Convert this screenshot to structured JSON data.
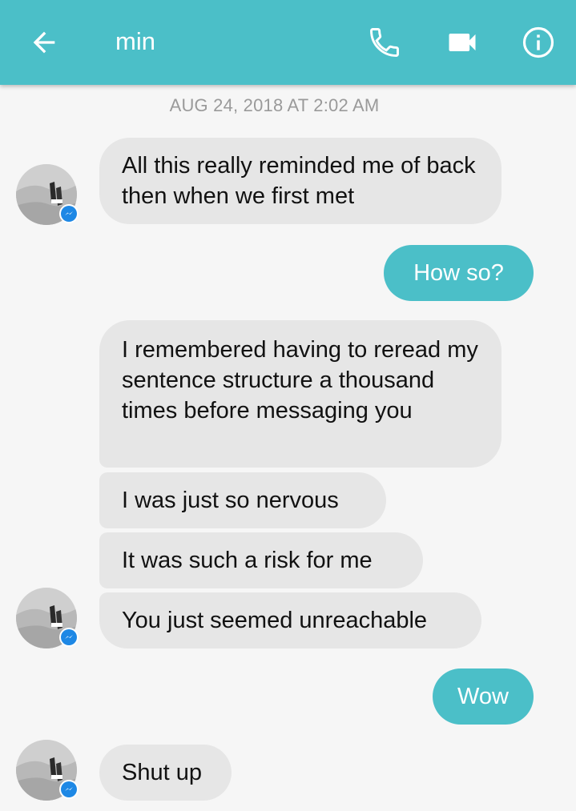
{
  "header": {
    "contact_name": "min",
    "back_icon": "arrow-left-icon",
    "call_icon": "phone-icon",
    "video_icon": "video-camera-icon",
    "info_icon": "info-icon",
    "bar_color": "#4bbfc8"
  },
  "conversation": {
    "timestamp": "AUG 24, 2018 AT 2:02 AM",
    "messages": [
      {
        "sender": "them",
        "text": "All this really reminded me of back then when we first met"
      },
      {
        "sender": "me",
        "text": "How so?"
      },
      {
        "sender": "them",
        "text": "I remembered having to reread my sentence structure a thousand times before messaging you"
      },
      {
        "sender": "them",
        "text": "I was just so nervous"
      },
      {
        "sender": "them",
        "text": "It was such a risk for me"
      },
      {
        "sender": "them",
        "text": "You just seemed unreachable"
      },
      {
        "sender": "me",
        "text": "Wow"
      },
      {
        "sender": "them",
        "text": "Shut up"
      }
    ]
  },
  "colors": {
    "incoming_bubble": "#e6e6e6",
    "outgoing_bubble": "#4bbfc8",
    "messenger_badge": "#1e88e5",
    "background": "#f6f6f6"
  }
}
